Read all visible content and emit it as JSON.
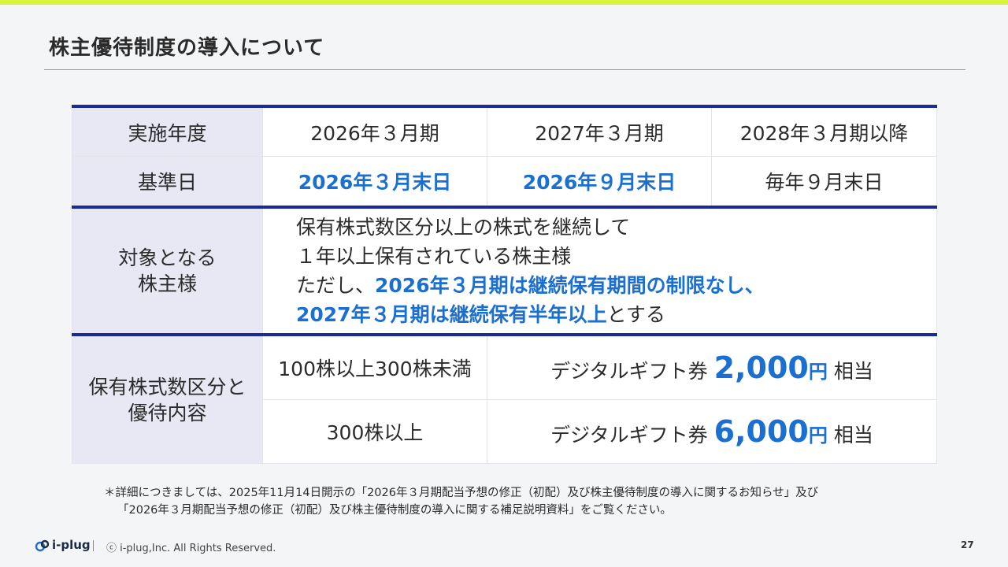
{
  "title": "株主優待制度の導入について",
  "table": {
    "row_period": {
      "label": "実施年度",
      "c1": "2026年３月期",
      "c2": "2027年３月期",
      "c3": "2028年３月期以降"
    },
    "row_basedate": {
      "label": "基準日",
      "c1": "2026年３月末日",
      "c2": "2026年９月末日",
      "c3": "毎年９月末日"
    },
    "row_target": {
      "label1": "対象となる",
      "label2": "株主様",
      "line1": "保有株式数区分以上の株式を継続して",
      "line2": "１年以上保有されている株主様",
      "line3_plain": "ただし、",
      "line3_bold": "2026年３月期は継続保有期間の制限なし、",
      "line4_bold": "2027年３月期は継続保有半年以上",
      "line4_plain": "とする"
    },
    "row_benefit": {
      "label1": "保有株式数区分と",
      "label2": "優待内容",
      "tier1": {
        "shares": "100株以上300株未満",
        "gift_prefix": "デジタルギフト券",
        "amount": "2,000",
        "yen": "円",
        "suffix": "相当"
      },
      "tier2": {
        "shares": "300株以上",
        "gift_prefix": "デジタルギフト券",
        "amount": "6,000",
        "yen": "円",
        "suffix": "相当"
      }
    }
  },
  "note": {
    "line1": "＊詳細につきましては、2025年11月14日開示の「2026年３月期配当予想の修正（初配）及び株主優待制度の導入に関するお知らせ」及び",
    "line2": "「2026年３月期配当予想の修正（初配）及び株主優待制度の導入に関する補足説明資料」をご覧ください。"
  },
  "footer": {
    "brand": "i-plug",
    "copyright": "ⓒ i-plug,Inc. All Rights Reserved.",
    "page": "27"
  },
  "colors": {
    "accent_blue": "#1a6fd0",
    "rule_navy": "#1a2a9c",
    "top_bar": "#d7f33a",
    "header_cell": "#e7e8f3"
  }
}
